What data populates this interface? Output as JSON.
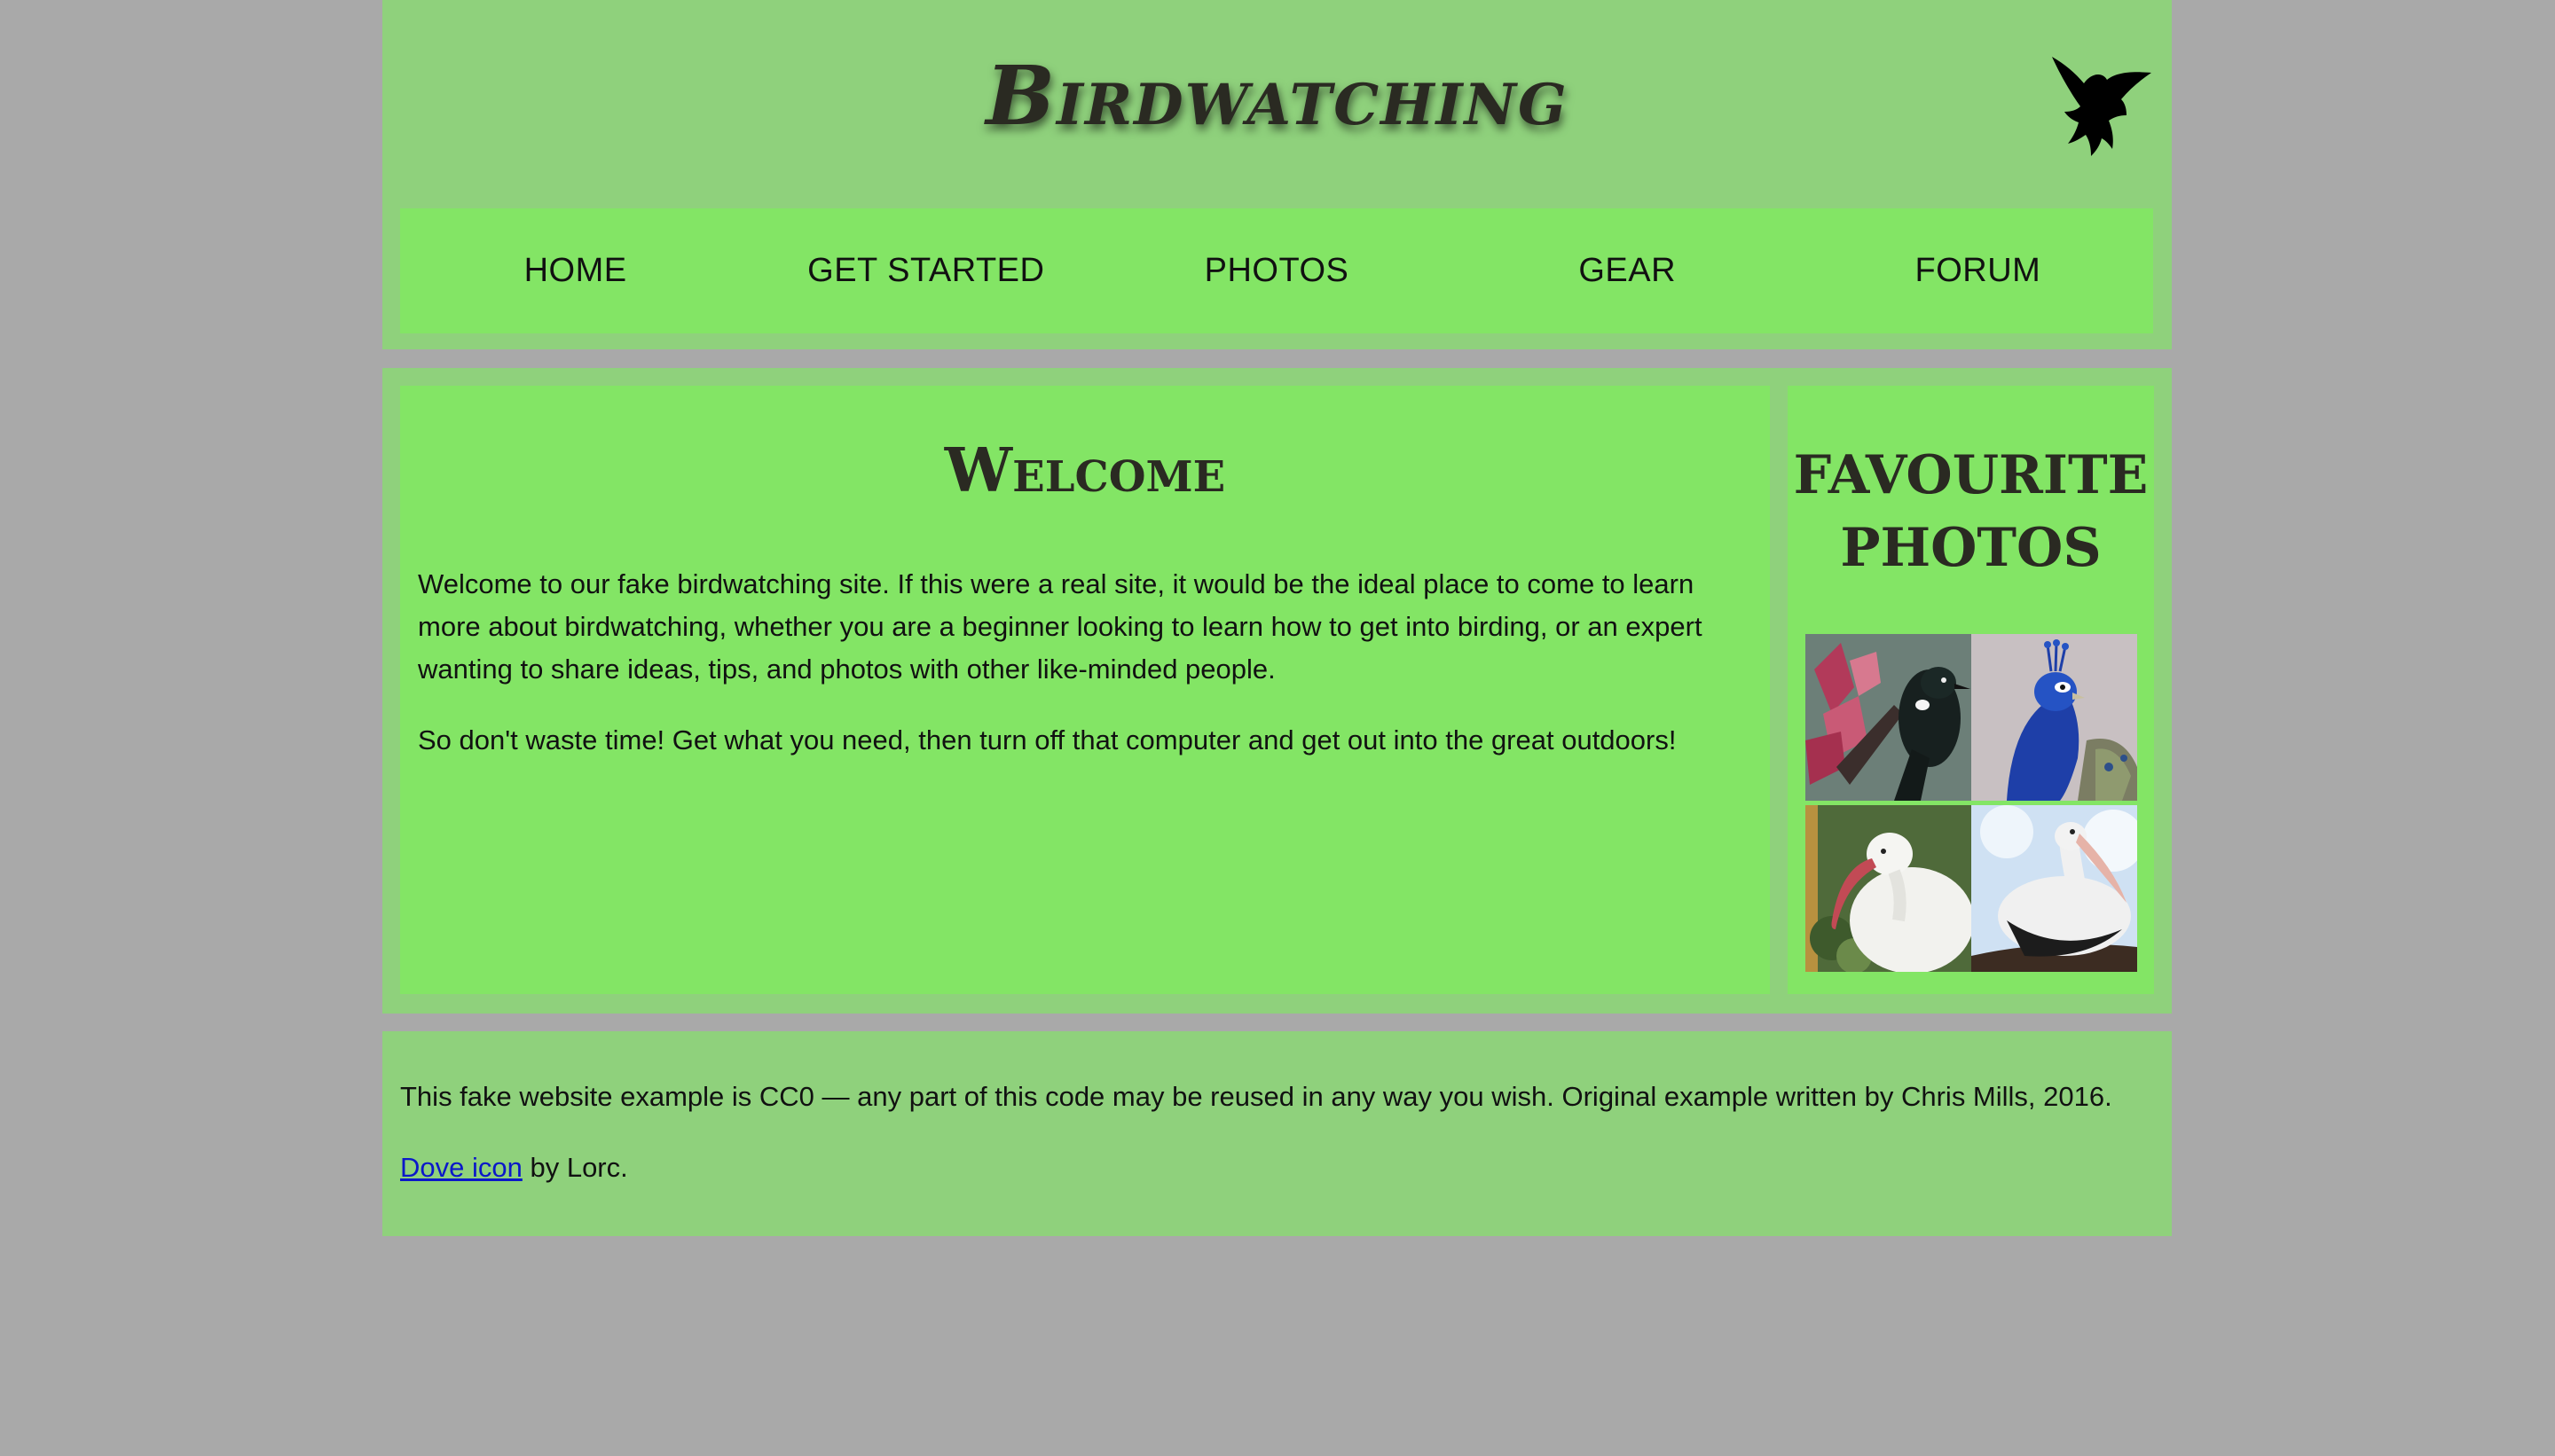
{
  "header": {
    "title": "Birdwatching",
    "logo_icon": "dove-icon"
  },
  "nav": {
    "items": [
      {
        "label": "HOME"
      },
      {
        "label": "GET STARTED"
      },
      {
        "label": "PHOTOS"
      },
      {
        "label": "GEAR"
      },
      {
        "label": "FORUM"
      }
    ]
  },
  "article": {
    "heading": "Welcome",
    "paragraph1": "Welcome to our fake birdwatching site. If this were a real site, it would be the ideal place to come to learn more about birdwatching, whether you are a beginner looking to learn how to get into birding, or an expert wanting to share ideas, tips, and photos with other like-minded people.",
    "paragraph2": "So don't waste time! Get what you need, then turn off that computer and get out into the great outdoors!"
  },
  "aside": {
    "heading": "Favourite photos",
    "photos": [
      {
        "subject": "tui"
      },
      {
        "subject": "peacock"
      },
      {
        "subject": "ibis"
      },
      {
        "subject": "pelican"
      }
    ]
  },
  "footer": {
    "license_text": "This fake website example is CC0 — any part of this code may be reused in any way you wish. Original example written by Chris Mills, 2016.",
    "credit_link": "Dove icon",
    "credit_suffix": " by Lorc."
  },
  "colors": {
    "page_bg": "#a9a9a9",
    "panel_bg": "#8fd17c",
    "inner_bg": "#83e565",
    "link": "#0b18c9"
  }
}
